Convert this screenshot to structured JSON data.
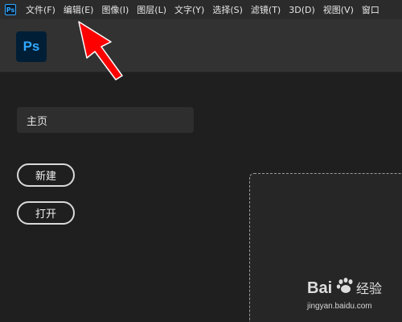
{
  "menubar": {
    "app_icon_text": "Ps",
    "items": [
      {
        "label": "文件(F)"
      },
      {
        "label": "编辑(E)"
      },
      {
        "label": "图像(I)"
      },
      {
        "label": "图层(L)"
      },
      {
        "label": "文字(Y)"
      },
      {
        "label": "选择(S)"
      },
      {
        "label": "滤镜(T)"
      },
      {
        "label": "3D(D)"
      },
      {
        "label": "视图(V)"
      },
      {
        "label": "窗口"
      }
    ]
  },
  "header": {
    "logo_text": "Ps"
  },
  "home": {
    "tab_label": "主页",
    "new_button": "新建",
    "open_button": "打开"
  },
  "annotation": {
    "arrow_color": "#ff0000",
    "points_to": "编辑(E)"
  },
  "watermark": {
    "brand_text": "Bai",
    "brand_text_2": "经验",
    "url": "jingyan.baidu.com"
  },
  "colors": {
    "background": "#1f1f1f",
    "menubar": "#2b2b2b",
    "optionsbar": "#323232",
    "ps_blue": "#31a8ff",
    "ps_dark": "#001e36"
  }
}
